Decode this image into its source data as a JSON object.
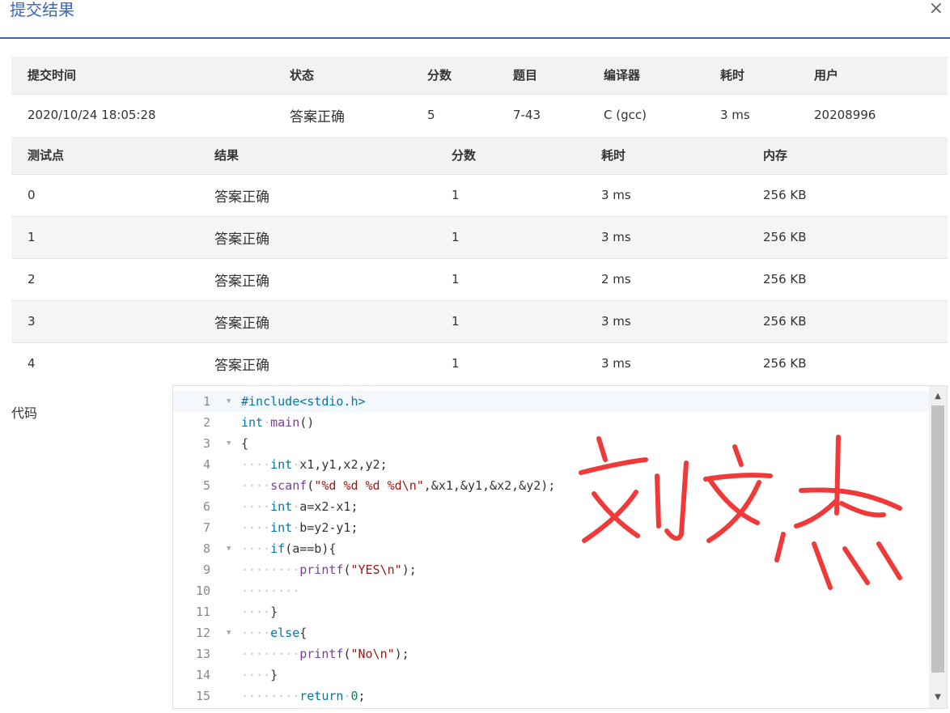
{
  "dialog": {
    "title": "提交结果",
    "close_glyph": "×"
  },
  "summary": {
    "headers": [
      "提交时间",
      "状态",
      "分数",
      "题目",
      "编译器",
      "耗时",
      "用户"
    ],
    "row": {
      "time": "2020/10/24 18:05:28",
      "status": "答案正确",
      "score": "5",
      "problem": "7-43",
      "compiler": "C (gcc)",
      "duration": "3 ms",
      "user": "20208996"
    }
  },
  "testcases": {
    "headers": [
      "测试点",
      "结果",
      "分数",
      "耗时",
      "内存"
    ],
    "rows": [
      {
        "id": "0",
        "result": "答案正确",
        "score": "1",
        "time": "3 ms",
        "memory": "256 KB"
      },
      {
        "id": "1",
        "result": "答案正确",
        "score": "1",
        "time": "3 ms",
        "memory": "256 KB"
      },
      {
        "id": "2",
        "result": "答案正确",
        "score": "1",
        "time": "2 ms",
        "memory": "256 KB"
      },
      {
        "id": "3",
        "result": "答案正确",
        "score": "1",
        "time": "3 ms",
        "memory": "256 KB"
      },
      {
        "id": "4",
        "result": "答案正确",
        "score": "1",
        "time": "3 ms",
        "memory": "256 KB"
      }
    ]
  },
  "code": {
    "label": "代码",
    "line_numbers": [
      "1",
      "2",
      "3",
      "4",
      "5",
      "6",
      "7",
      "8",
      "9",
      "10",
      "11",
      "12",
      "13",
      "14",
      "15"
    ],
    "lines": [
      "#include<stdio.h>",
      "int main()",
      "{",
      "    int x1,y1,x2,y2;",
      "    scanf(\"%d %d %d %d\\n\",&x1,&y1,&x2,&y2);",
      "    int a=x2-x1;",
      "    int b=y2-y1;",
      "    if(a==b){",
      "        printf(\"YES\\n\");",
      "        ",
      "    }",
      "    else{",
      "        printf(\"No\\n\");",
      "    }",
      "        return 0;"
    ],
    "fold_lines": [
      "1",
      "3",
      "8",
      "12"
    ]
  },
  "overlay": {
    "handwriting_text": "刘文杰",
    "color": "#f03a3a"
  },
  "colors": {
    "accent": "#3a67c0",
    "success": "#e63939",
    "link": "#2d6bb5"
  }
}
